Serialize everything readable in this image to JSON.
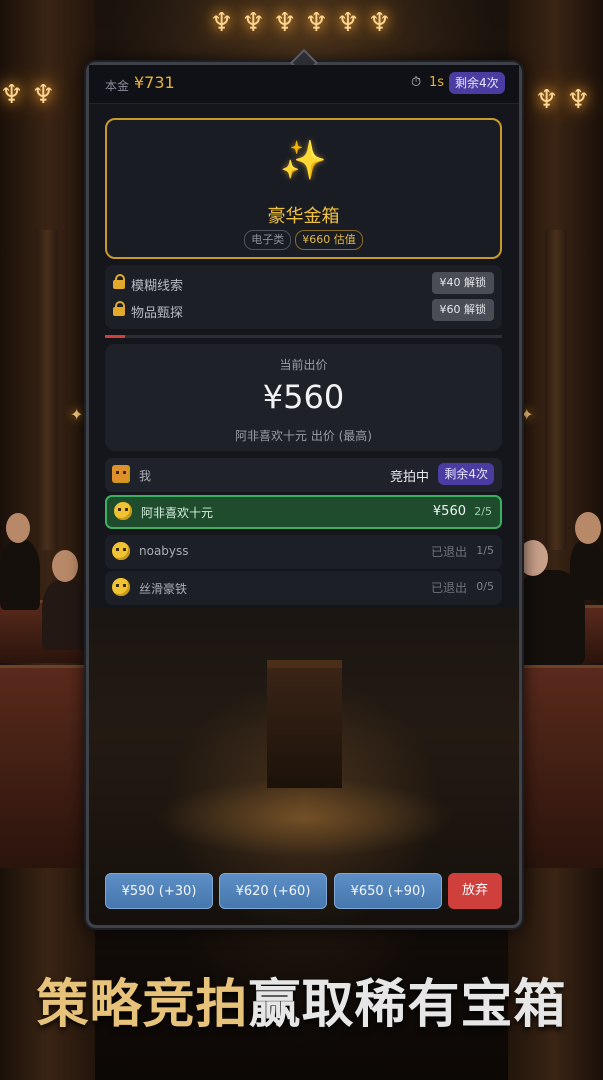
{
  "status_bar": {
    "balance_label": "本金",
    "balance_value": "¥731",
    "timer_value": "1s",
    "remaining_label": "剩余4次"
  },
  "prize": {
    "name": "豪华金箱",
    "category": "电子类",
    "estimate": "¥660 估值"
  },
  "clues": [
    {
      "label": "模糊线索",
      "unlock": "¥40 解锁"
    },
    {
      "label": "物品甄探",
      "unlock": "¥60 解锁"
    }
  ],
  "timer_progress": 0.05,
  "current_bid": {
    "title": "当前出价",
    "amount": "¥560",
    "leader": "阿非喜欢十元 出价 (最高)"
  },
  "players": {
    "me": {
      "name": "我",
      "status": "竞拍中",
      "remaining": "剩余4次"
    },
    "p1": {
      "name": "阿非喜欢十元",
      "bid": "¥560",
      "count": "2/5"
    },
    "p2": {
      "name": "noabyss",
      "status": "已退出",
      "count": "1/5"
    },
    "p3": {
      "name": "丝滑豪铁",
      "status": "已退出",
      "count": "0/5"
    }
  },
  "actions": {
    "bid1": "¥590 (+30)",
    "bid2": "¥620 (+60)",
    "bid3": "¥650 (+90)",
    "give_up": "放弃"
  },
  "slogan": {
    "part1": "策略竞拍",
    "part2": "赢取稀有宝箱"
  },
  "colors": {
    "accent_gold": "#e3b23c",
    "leader_green": "#3bb060",
    "bid_blue": "#4677ad",
    "give_up_red": "#cf3f3c",
    "chip_purple": "#4a3ca0"
  },
  "icons": {
    "prize": "sparkle-icon",
    "clue": "lock-icon",
    "timer": "stopwatch-icon",
    "avatar": "emoji-face-icon"
  }
}
